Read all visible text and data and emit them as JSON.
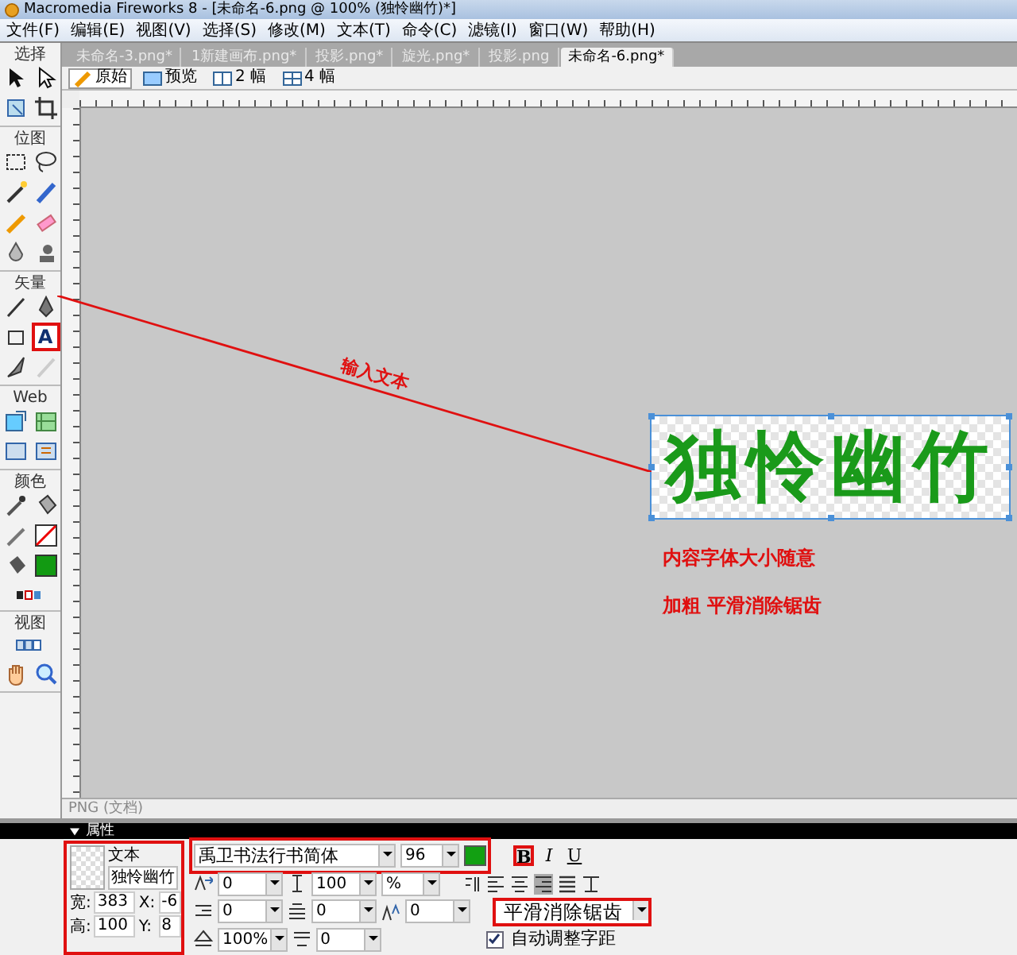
{
  "window": {
    "title": "Macromedia Fireworks 8 - [未命名-6.png @ 100% (独怜幽竹)*]"
  },
  "menu": [
    "文件(F)",
    "编辑(E)",
    "视图(V)",
    "选择(S)",
    "修改(M)",
    "文本(T)",
    "命令(C)",
    "滤镜(I)",
    "窗口(W)",
    "帮助(H)"
  ],
  "toolbox": [
    {
      "title": "选择",
      "tools": [
        {
          "kind": "pointer"
        },
        {
          "kind": "subselect"
        },
        {
          "kind": "scale"
        },
        {
          "kind": "crop"
        }
      ]
    },
    {
      "title": "位图",
      "tools": [
        {
          "kind": "marquee"
        },
        {
          "kind": "lasso"
        },
        {
          "kind": "wand"
        },
        {
          "kind": "brush"
        },
        {
          "kind": "pencil"
        },
        {
          "kind": "eraser"
        },
        {
          "kind": "blur"
        },
        {
          "kind": "stamp"
        }
      ]
    },
    {
      "title": "矢量",
      "tools": [
        {
          "kind": "line"
        },
        {
          "kind": "pen"
        },
        {
          "kind": "rect"
        },
        {
          "kind": "text",
          "glyph": "A",
          "highlighted": true
        },
        {
          "kind": "knife"
        },
        {
          "kind": "freeform"
        }
      ]
    },
    {
      "title": "Web",
      "tools": [
        {
          "kind": "hotspot"
        },
        {
          "kind": "slice"
        },
        {
          "kind": "hide"
        },
        {
          "kind": "show"
        }
      ]
    },
    {
      "title": "颜色",
      "tools": [
        {
          "kind": "eyedropper"
        },
        {
          "kind": "bucket"
        },
        {
          "kind": "stroke"
        },
        {
          "kind": "stroke-swatch"
        },
        {
          "kind": "fill"
        },
        {
          "kind": "fill-swatch"
        },
        {
          "kind": "small-swatches"
        }
      ]
    },
    {
      "title": "视图",
      "tools": [
        {
          "kind": "screens"
        },
        {
          "kind": "hand"
        },
        {
          "kind": "zoom"
        }
      ]
    }
  ],
  "document_tabs": [
    {
      "label": "未命名-3.png*",
      "selected": false
    },
    {
      "label": "1新建画布.png*",
      "selected": false
    },
    {
      "label": "投影.png*",
      "selected": false
    },
    {
      "label": "旋光.png*",
      "selected": false
    },
    {
      "label": "投影.png",
      "selected": false
    },
    {
      "label": "未命名-6.png*",
      "selected": true
    }
  ],
  "view_modes": [
    {
      "kind": "original",
      "label": "原始",
      "selected": true
    },
    {
      "kind": "preview",
      "label": "预览",
      "selected": false
    },
    {
      "kind": "two-up",
      "label": "2 幅",
      "selected": false
    },
    {
      "kind": "four-up",
      "label": "4 幅",
      "selected": false
    }
  ],
  "canvas": {
    "text": "独怜幽竹",
    "color": "#1a9a1a",
    "selected": true
  },
  "annotations": [
    {
      "kind": "arrow-label",
      "text": "输入文本"
    },
    {
      "kind": "note",
      "text": "内容字体大小随意"
    },
    {
      "kind": "note",
      "text": "加粗  平滑消除锯齿"
    }
  ],
  "status_bar": "PNG (文档)",
  "properties": {
    "title": "属性",
    "object_type": "文本",
    "name": "独怜幽竹",
    "highlighted": true,
    "sizes": [
      {
        "label": "宽:",
        "value": "383"
      },
      {
        "label": "X:",
        "value": "-6"
      },
      {
        "label": "高:",
        "value": "100"
      },
      {
        "label": "Y:",
        "value": "8"
      }
    ],
    "font": {
      "name": "禹卫书法行书简体",
      "size": "96",
      "color": "#12a012",
      "highlighted": true
    },
    "styles": [
      {
        "kind": "bold",
        "glyph": "B",
        "selected": true
      },
      {
        "kind": "italic",
        "glyph": "I",
        "selected": false
      },
      {
        "kind": "underline",
        "glyph": "U",
        "selected": false
      }
    ],
    "spacing_rows": [
      [
        {
          "kind": "kerning",
          "value": "0"
        },
        {
          "kind": "leading",
          "value": "100"
        }
      ],
      [
        {
          "kind": "indent",
          "value": "0"
        },
        {
          "kind": "space-before",
          "value": "0"
        },
        {
          "kind": "baseline",
          "value": "0"
        }
      ],
      [
        {
          "kind": "scale",
          "value": "100%"
        },
        {
          "kind": "space-after",
          "value": "0"
        }
      ]
    ],
    "leading_unit": "%",
    "alignment": [
      {
        "kind": "orient",
        "selected": false
      },
      {
        "kind": "left",
        "selected": false
      },
      {
        "kind": "center",
        "selected": false
      },
      {
        "kind": "right",
        "selected": true
      },
      {
        "kind": "justify",
        "selected": false
      },
      {
        "kind": "stretch",
        "selected": false
      }
    ],
    "anti_alias": {
      "value": "平滑消除锯齿",
      "highlighted": true
    },
    "auto_kern": {
      "label": "自动调整字距",
      "checked": true
    }
  }
}
